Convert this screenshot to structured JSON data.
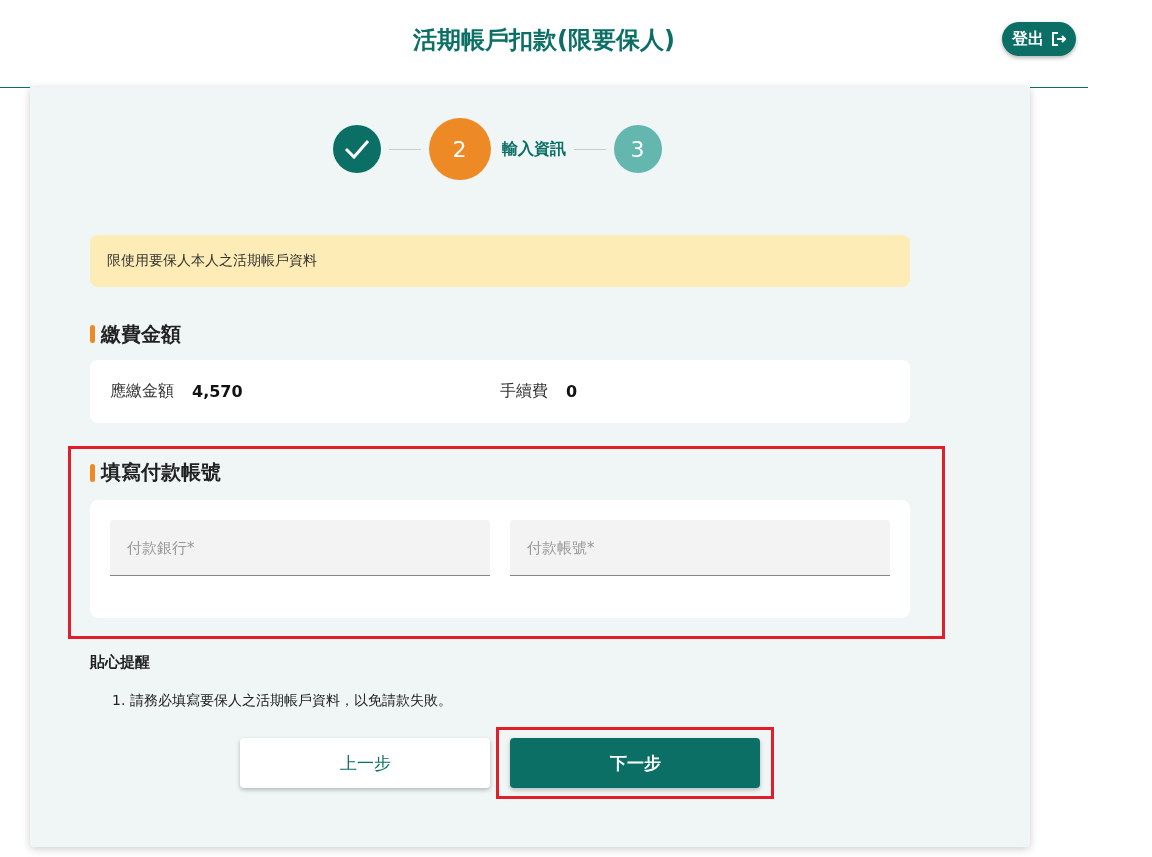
{
  "header": {
    "title": "活期帳戶扣款(限要保人)",
    "logout_button": "登出"
  },
  "steps": [
    {
      "kind": "done"
    },
    {
      "kind": "current",
      "number": "2",
      "label": "輸入資訊"
    },
    {
      "kind": "todo",
      "number": "3"
    }
  ],
  "notice": "限使用要保人本人之活期帳戶資料",
  "amount_section": {
    "title": "繳費金額",
    "items": [
      {
        "label": "應繳金額",
        "value": "4,570"
      },
      {
        "label": "手續費",
        "value": "0"
      }
    ]
  },
  "account_section": {
    "title": "填寫付款帳號",
    "highlighted": true,
    "fields": [
      {
        "placeholder": "付款銀行*"
      },
      {
        "placeholder": "付款帳號*"
      }
    ]
  },
  "tips": {
    "title": "貼心提醒",
    "items": [
      "1. 請務必填寫要保人之活期帳戶資料，以免請款失敗。"
    ]
  },
  "buttons": [
    {
      "label": "上一步",
      "kind": "secondary",
      "highlighted": false
    },
    {
      "label": "下一步",
      "kind": "primary",
      "highlighted": true
    }
  ]
}
